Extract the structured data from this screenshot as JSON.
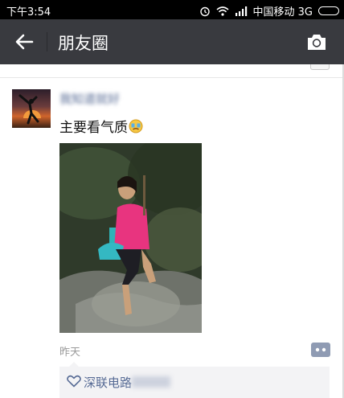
{
  "status_bar": {
    "time": "下午3:54",
    "carrier": "中国移动 3G",
    "icons": [
      "alarm-icon",
      "wifi-icon",
      "signal-icon",
      "battery-icon"
    ]
  },
  "header": {
    "title": "朋友圈",
    "back_icon": "back-arrow-icon",
    "camera_icon": "camera-icon",
    "background": "#393a3f"
  },
  "post": {
    "username": "我知道就好",
    "text": "主要看气质",
    "emoji": "crying-emoji",
    "timestamp": "昨天",
    "likes": {
      "name": "深联电路"
    }
  },
  "colors": {
    "link": "#576b95",
    "muted": "#9a9a9a"
  }
}
